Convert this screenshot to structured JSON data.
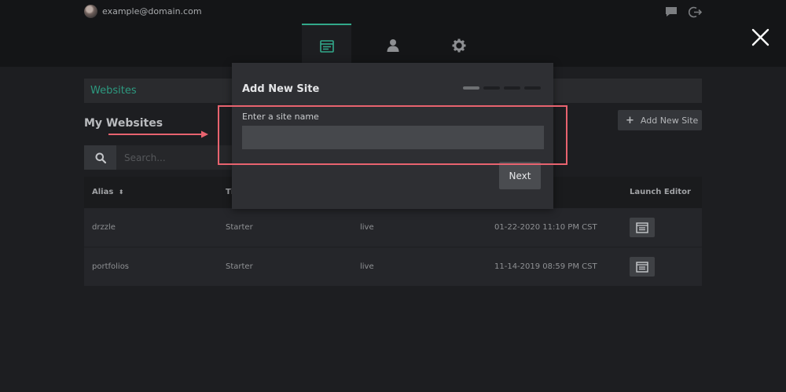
{
  "topbar": {
    "email": "example@domain.com",
    "icons": {
      "chat": "chat-icon",
      "signout": "sign-out-icon"
    }
  },
  "nav": {
    "tabs": [
      {
        "name": "websites",
        "icon": "browser-window-icon",
        "active": true
      },
      {
        "name": "account",
        "icon": "user-icon",
        "active": false
      },
      {
        "name": "settings",
        "icon": "gear-icon",
        "active": false
      }
    ],
    "close_icon": "close-icon"
  },
  "main": {
    "breadcrumb": "Websites",
    "page_title": "My Websites",
    "add_site_label": "Add New Site",
    "search": {
      "placeholder": "Search..."
    },
    "table": {
      "headers": {
        "alias": "Alias",
        "tier": "Ti",
        "launch": "Launch Editor"
      },
      "rows": [
        {
          "alias": "drzzle",
          "tier": "Starter",
          "status": "live",
          "date": "01-22-2020 11:10 PM CST"
        },
        {
          "alias": "portfolios",
          "tier": "Starter",
          "status": "live",
          "date": "11-14-2019 08:59 PM CST"
        }
      ]
    }
  },
  "modal": {
    "title": "Add New Site",
    "steps_total": 4,
    "current_step": 1,
    "field_label": "Enter a site name",
    "field_value": "",
    "next_label": "Next"
  },
  "colors": {
    "accent": "#32a88a",
    "annotation": "#e8636f",
    "background": "#1d1e21",
    "modal": "#2e2f33"
  }
}
